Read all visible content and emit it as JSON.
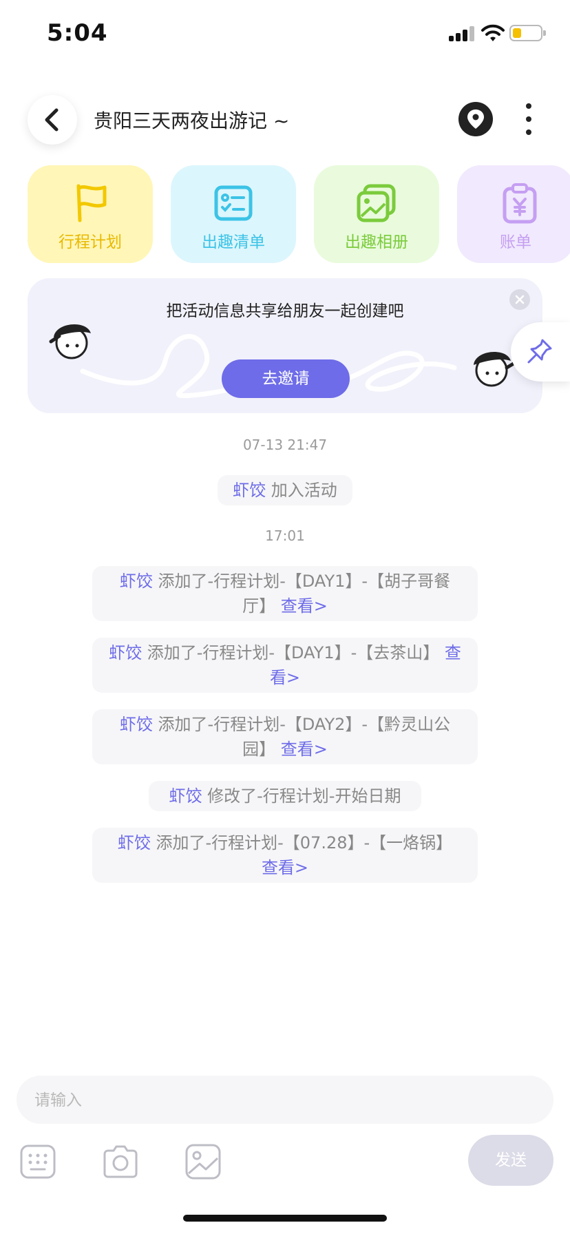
{
  "status_bar": {
    "time": "5:04"
  },
  "header": {
    "title": "贵阳三天两夜出游记 ~"
  },
  "quick_tiles": [
    {
      "label": "行程计划",
      "icon": "flag-icon"
    },
    {
      "label": "出趣清单",
      "icon": "checklist-card-icon"
    },
    {
      "label": "出趣相册",
      "icon": "photo-album-icon"
    },
    {
      "label": "账单",
      "icon": "bill-clipboard-icon"
    }
  ],
  "banner": {
    "text": "把活动信息共享给朋友一起创建吧",
    "invite_label": "去邀请"
  },
  "timeline": {
    "timestamps": [
      "07-13 21:47",
      "17:01"
    ],
    "messages": [
      {
        "user": "虾饺",
        "text": " 加入活动",
        "link": ""
      },
      {
        "user": "虾饺",
        "text": " 添加了-行程计划-【DAY1】-【胡子哥餐厅】",
        "link": "查看>"
      },
      {
        "user": "虾饺",
        "text": " 添加了-行程计划-【DAY1】-【去茶山】",
        "link": "查看>"
      },
      {
        "user": "虾饺",
        "text": " 添加了-行程计划-【DAY2】-【黔灵山公园】",
        "link": "查看>"
      },
      {
        "user": "虾饺",
        "text": " 修改了-行程计划-开始日期",
        "link": ""
      },
      {
        "user": "虾饺",
        "text": " 添加了-行程计划-【07.28】-【一烙锅】",
        "link": "查看>"
      }
    ]
  },
  "composer": {
    "placeholder": "请输入",
    "send_label": "发送"
  },
  "colors": {
    "accent": "#6e6ce8",
    "tile_plan": "#fff6b8",
    "tile_list": "#dcf6fd",
    "tile_album": "#e9fbdc",
    "tile_bill": "#f1e9fd"
  }
}
